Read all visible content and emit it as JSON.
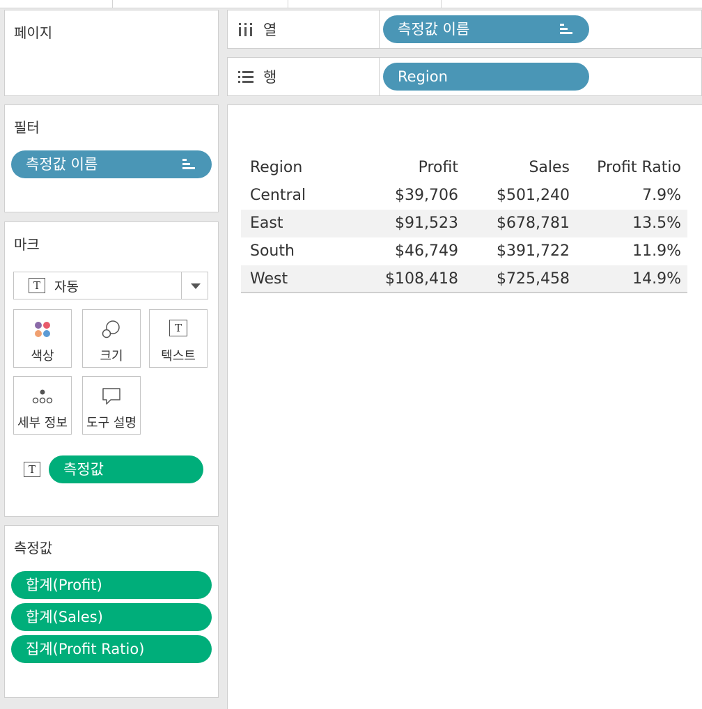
{
  "shelves": {
    "pages": {
      "title": "페이지"
    },
    "columns": {
      "label": "열",
      "pill": "측정값 이름"
    },
    "rows": {
      "label": "행",
      "pill": "Region"
    }
  },
  "filters": {
    "title": "필터",
    "pill": "측정값 이름"
  },
  "marks": {
    "title": "마크",
    "mark_type": "자동",
    "buttons": {
      "color": "색상",
      "size": "크기",
      "text": "텍스트",
      "detail": "세부 정보",
      "tooltip": "도구 설명"
    },
    "text_pill": "측정값"
  },
  "measure_values": {
    "title": "측정값",
    "items": [
      "합계(Profit)",
      "합계(Sales)",
      "집계(Profit Ratio)"
    ]
  },
  "table": {
    "headers": [
      "Region",
      "Profit",
      "Sales",
      "Profit Ratio"
    ],
    "rows": [
      [
        "Central",
        "$39,706",
        "$501,240",
        "7.9%"
      ],
      [
        "East",
        "$91,523",
        "$678,781",
        "13.5%"
      ],
      [
        "South",
        "$46,749",
        "$391,722",
        "11.9%"
      ],
      [
        "West",
        "$108,418",
        "$725,458",
        "14.9%"
      ]
    ]
  },
  "colors": {
    "dimension_pill": "#4a96b6",
    "measure_pill": "#00ae7a",
    "alt_row": "#f2f2f2"
  },
  "icons": {
    "columns_shelf": "columns-icon",
    "rows_shelf": "rows-icon",
    "sort": "sort-icon",
    "mark_type": "text-mark-icon",
    "color": "color-dots-icon",
    "size": "size-circles-icon",
    "text": "text-mark-icon",
    "detail": "detail-dots-icon",
    "tooltip": "speech-bubble-icon"
  }
}
